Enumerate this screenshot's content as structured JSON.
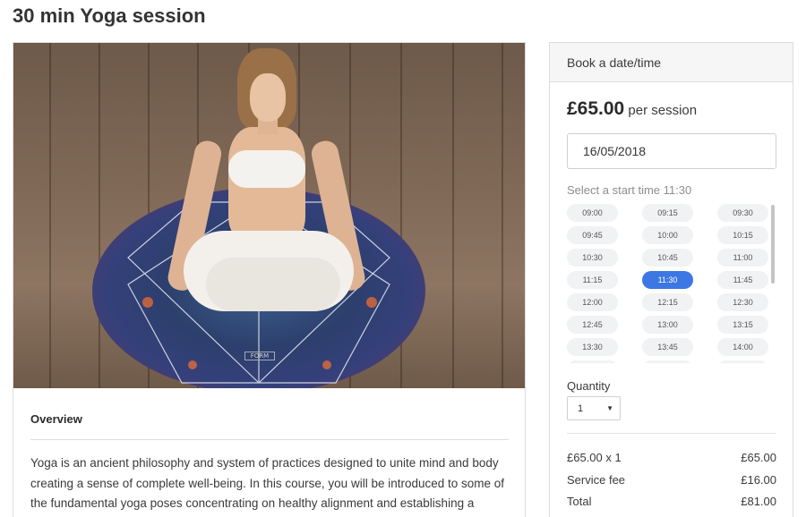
{
  "page": {
    "title": "30 min Yoga session"
  },
  "overview": {
    "heading": "Overview",
    "body": "Yoga is an ancient philosophy and system of practices designed to unite mind and body creating a sense of complete well-being. In this course, you will be introduced to some of the fundamental yoga poses concentrating on healthy alignment and establishing a deeper awareness of your breathing. Instruction in meditation and relaxation techniques"
  },
  "hero": {
    "mat_label": "FORM"
  },
  "booking": {
    "header": "Book a date/time",
    "price_amount": "£65.00",
    "price_unit": "per session",
    "date_value": "16/05/2018",
    "start_label": "Select a start time 11:30",
    "selected_time": "11:30",
    "times": [
      "09:00",
      "09:15",
      "09:30",
      "09:45",
      "10:00",
      "10:15",
      "10:30",
      "10:45",
      "11:00",
      "11:15",
      "11:30",
      "11:45",
      "12:00",
      "12:15",
      "12:30",
      "12:45",
      "13:00",
      "13:15",
      "13:30",
      "13:45",
      "14:00"
    ],
    "quantity_label": "Quantity",
    "quantity_value": "1",
    "quantity_caret": "▼",
    "summary": {
      "line_label": "£65.00 x 1",
      "line_value": "£65.00",
      "fee_label": "Service fee",
      "fee_value": "£16.00",
      "total_label": "Total",
      "total_value": "£81.00"
    },
    "accent_color": "#3c77e3"
  }
}
